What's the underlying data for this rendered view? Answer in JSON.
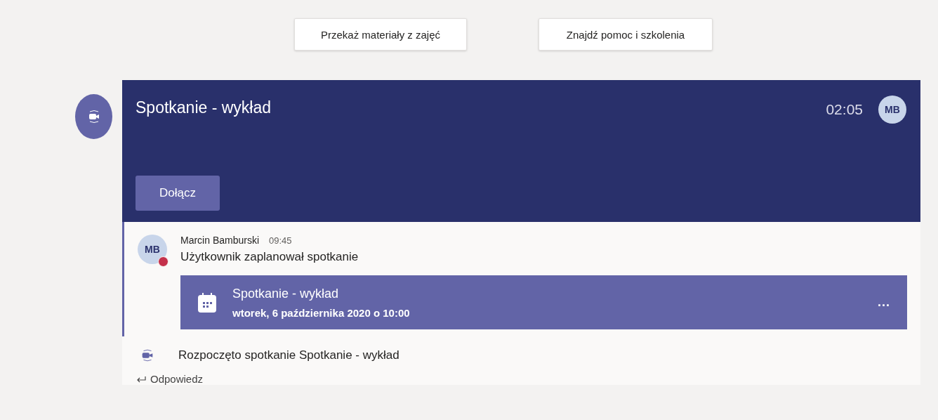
{
  "top_buttons": [
    {
      "label": "Przekaż materiały z zajęć"
    },
    {
      "label": "Znajdź pomoc i szkolenia"
    }
  ],
  "meeting": {
    "title": "Spotkanie - wykład",
    "duration": "02:05",
    "avatar": "MB",
    "join_button": "Dołącz"
  },
  "message": {
    "avatar": "MB",
    "author": "Marcin Bamburski",
    "time": "09:45",
    "text": "Użytkownik zaplanował spotkanie",
    "card": {
      "title": "Spotkanie - wykład",
      "date": "wtorek, 6 października 2020 o 10:00",
      "more": "..."
    }
  },
  "event": {
    "text": "Rozpoczęto spotkanie Spotkanie - wykład"
  },
  "reply": {
    "label": "Odpowiedz"
  }
}
